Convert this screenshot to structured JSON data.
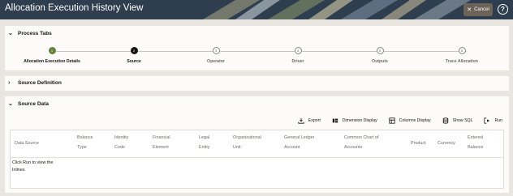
{
  "header": {
    "title": "Allocation Execution History View",
    "cancel_label": "Cancel",
    "help_label": "?"
  },
  "process_tabs": {
    "title": "Process Tabs",
    "steps": [
      {
        "num": "1",
        "label": "Allocation Execution Details",
        "state": "done"
      },
      {
        "num": "2",
        "label": "Source",
        "state": "active"
      },
      {
        "num": "3",
        "label": "Operator",
        "state": "pending"
      },
      {
        "num": "4",
        "label": "Driver",
        "state": "pending"
      },
      {
        "num": "5",
        "label": "Outputs",
        "state": "pending"
      },
      {
        "num": "6",
        "label": "Trace Allocation",
        "state": "pending"
      }
    ]
  },
  "source_definition": {
    "title": "Source Definition"
  },
  "source_data": {
    "title": "Source Data",
    "toolbar": {
      "export": "Export",
      "dimension_display": "Dimension Display",
      "columns_display": "Columns Display",
      "show_sql": "Show SQL",
      "run": "Run"
    },
    "columns": [
      [
        "Data Source"
      ],
      [
        "Balance",
        "Type"
      ],
      [
        "Identity",
        "Code"
      ],
      [
        "Financial",
        "Element"
      ],
      [
        "Legal",
        "Entity"
      ],
      [
        "Organizational",
        "Unit"
      ],
      [
        "General Ledger",
        "Account"
      ],
      [
        "Common Chart of",
        "Accounts"
      ],
      [
        "Product"
      ],
      [
        "Currency"
      ],
      [
        "Entered",
        "Balance"
      ]
    ],
    "empty_message": [
      "Click Run to view the",
      "Inlines"
    ]
  },
  "colors": {
    "header_bg": "#2f3e4f",
    "step_done": "#64803a",
    "step_active": "#161513",
    "cancel_bg": "#6b6258"
  }
}
